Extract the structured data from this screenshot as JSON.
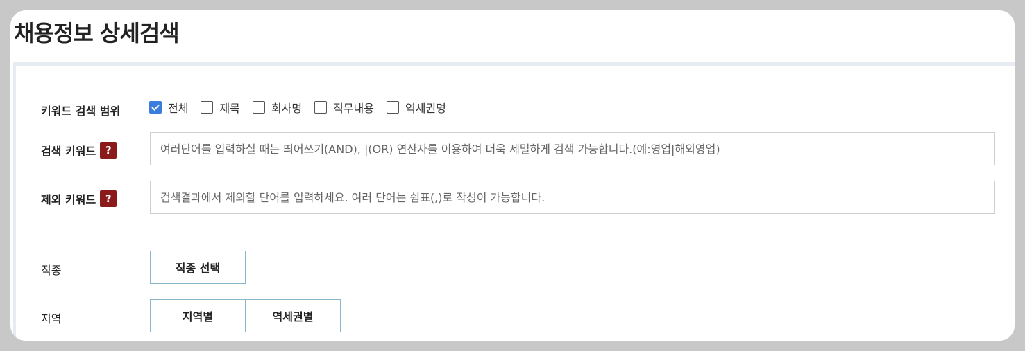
{
  "page": {
    "title": "채용정보 상세검색"
  },
  "keyword_scope": {
    "label": "키워드 검색 범위",
    "options": [
      {
        "label": "전체",
        "checked": true
      },
      {
        "label": "제목",
        "checked": false
      },
      {
        "label": "회사명",
        "checked": false
      },
      {
        "label": "직무내용",
        "checked": false
      },
      {
        "label": "역세권명",
        "checked": false
      }
    ]
  },
  "search_keyword": {
    "label": "검색 키워드",
    "help": "?",
    "placeholder": "여러단어를 입력하실 때는 띄어쓰기(AND), |(OR) 연산자를 이용하여 더욱 세밀하게 검색 가능합니다.(예:영업|해외영업)",
    "value": ""
  },
  "exclude_keyword": {
    "label": "제외 키워드",
    "help": "?",
    "placeholder": "검색결과에서 제외할 단어를 입력하세요. 여러 단어는 쉼표(,)로 작성이 가능합니다.",
    "value": ""
  },
  "job_type": {
    "label": "직종",
    "button": "직종 선택"
  },
  "region": {
    "label": "지역",
    "buttons": [
      "지역별",
      "역세권별"
    ]
  },
  "colors": {
    "accent": "#3b7ddd",
    "help_badge": "#8b1a1a",
    "button_border": "#8ab6c9"
  }
}
